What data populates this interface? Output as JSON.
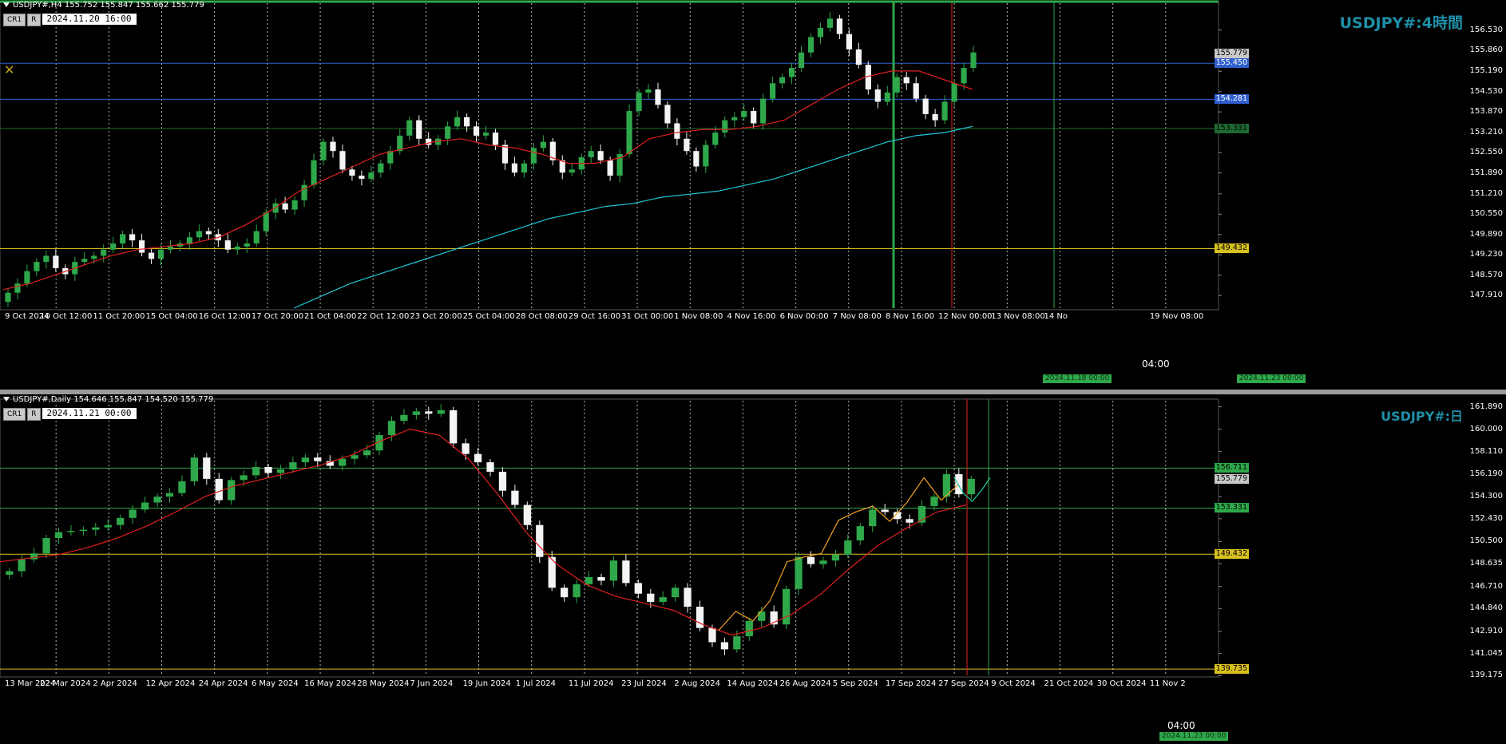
{
  "top": {
    "header": "USDJPY#,H4  155.752 155.847 155.662 155.779",
    "btn1": "CR1",
    "btn2": "R",
    "datetime": "2024.11.20 16:00",
    "title": "USDJPY#:4時間",
    "time_marker": "04:00",
    "x_badge1": "2024.11.18 00:00",
    "x_badge2": "2024.11.23 00:00",
    "chart_data": {
      "type": "candlestick",
      "symbol": "USDJPY#",
      "timeframe": "H4",
      "ylim": [
        147.5,
        157.4
      ],
      "y_ticks": [
        "156.530",
        "155.860",
        "155.190",
        "154.530",
        "153.870",
        "153.210",
        "152.550",
        "151.890",
        "151.210",
        "150.550",
        "149.890",
        "149.230",
        "148.570",
        "147.910"
      ],
      "x_ticks": [
        "9 Oct 2024",
        "10 Oct 12:00",
        "11 Oct 20:00",
        "15 Oct 04:00",
        "16 Oct 12:00",
        "17 Oct 20:00",
        "21 Oct 04:00",
        "22 Oct 12:00",
        "23 Oct 20:00",
        "25 Oct 04:00",
        "28 Oct 08:00",
        "29 Oct 16:00",
        "31 Oct 00:00",
        "1 Nov 08:00",
        "4 Nov 16:00",
        "6 Nov 00:00",
        "7 Nov 08:00",
        "8 Nov 16:00",
        "12 Nov 00:00",
        "13 Nov 08:00",
        "14 No",
        "",
        "19 Nov 08:00"
      ],
      "closes": [
        148.0,
        148.3,
        148.7,
        149.0,
        149.2,
        148.8,
        148.6,
        149.0,
        149.1,
        149.2,
        149.4,
        149.6,
        149.9,
        149.7,
        149.3,
        149.1,
        149.4,
        149.5,
        149.6,
        149.8,
        150.0,
        149.9,
        149.7,
        149.4,
        149.5,
        149.6,
        150.0,
        150.6,
        150.9,
        150.7,
        151.0,
        151.5,
        152.3,
        152.9,
        152.6,
        152.0,
        151.8,
        151.7,
        151.9,
        152.2,
        152.6,
        153.1,
        153.6,
        153.0,
        152.8,
        153.0,
        153.4,
        153.7,
        153.4,
        153.1,
        153.2,
        152.8,
        152.2,
        151.9,
        152.2,
        152.7,
        152.9,
        152.3,
        151.9,
        152.0,
        152.4,
        152.6,
        152.3,
        151.8,
        152.5,
        153.9,
        154.5,
        154.6,
        154.1,
        153.5,
        153.0,
        152.6,
        152.1,
        152.8,
        153.2,
        153.6,
        153.7,
        153.9,
        153.5,
        154.3,
        154.8,
        155.0,
        155.3,
        155.8,
        156.3,
        156.6,
        156.9,
        156.4,
        155.9,
        155.4,
        154.6,
        154.2,
        154.5,
        155.0,
        154.8,
        154.3,
        153.8,
        153.6,
        154.2,
        154.8,
        155.3,
        155.8
      ],
      "moving_averages": [
        {
          "color": "#e02020",
          "values": [
            148.1,
            148.3,
            148.6,
            148.9,
            149.2,
            149.4,
            149.5,
            149.6,
            149.8,
            150.2,
            150.7,
            151.3,
            151.7,
            152.1,
            152.5,
            152.7,
            152.9,
            153.0,
            152.8,
            152.7,
            152.5,
            152.2,
            152.2,
            152.4,
            153.0,
            153.2,
            153.3,
            153.3,
            153.4,
            153.6,
            154.1,
            154.6,
            155.0,
            155.2,
            155.2,
            154.9,
            154.6
          ]
        },
        {
          "color": "#20c8d8",
          "values": [
            147.5,
            147.9,
            148.3,
            148.6,
            148.9,
            149.2,
            149.5,
            149.8,
            150.1,
            150.4,
            150.6,
            150.8,
            150.9,
            151.1,
            151.2,
            151.3,
            151.5,
            151.7,
            152.0,
            152.3,
            152.6,
            152.9,
            153.1,
            153.2,
            153.4
          ]
        }
      ],
      "horizontal_levels": [
        {
          "label": "155.779",
          "value": 155.779,
          "color": "#c8c8c8"
        },
        {
          "label": "155.450",
          "value": 155.45,
          "color": "#3060d0"
        },
        {
          "label": "154.281",
          "value": 154.281,
          "color": "#3060d0"
        },
        {
          "label": "153.331",
          "value": 153.331,
          "color": "#1e6b30"
        },
        {
          "label": "149.432",
          "value": 149.432,
          "color": "#d8c020"
        }
      ]
    }
  },
  "bottom": {
    "header": "USDJPY#,Daily  154.646 155.847 154.520 155.779",
    "btn1": "CR1",
    "btn2": "R",
    "datetime": "2024.11.21 00:00",
    "title": "USDJPY#:日",
    "time_marker": "04:00",
    "x_badge1": "2024.11.23 00:00",
    "chart_data": {
      "type": "candlestick",
      "symbol": "USDJPY#",
      "timeframe": "Daily",
      "ylim": [
        139.2,
        162.4
      ],
      "y_ticks": [
        "161.890",
        "160.000",
        "158.110",
        "156.190",
        "154.300",
        "152.430",
        "150.500",
        "148.635",
        "146.710",
        "144.840",
        "142.910",
        "141.045",
        "139.175"
      ],
      "x_ticks": [
        "13 Mar 2024",
        "22 Mar 2024",
        "2 Apr 2024",
        "12 Apr 2024",
        "24 Apr 2024",
        "6 May 2024",
        "16 May 2024",
        "28 May 2024",
        "7 Jun 2024",
        "19 Jun 2024",
        "1 Jul 2024",
        "11 Jul 2024",
        "23 Jul 2024",
        "2 Aug 2024",
        "14 Aug 2024",
        "26 Aug 2024",
        "5 Sep 2024",
        "17 Sep 2024",
        "27 Sep 2024",
        "9 Oct 2024",
        "21 Oct 2024",
        "30 Oct 2024",
        "11 Nov 2"
      ],
      "closes": [
        148.0,
        149.0,
        149.5,
        150.8,
        151.3,
        151.4,
        151.5,
        151.7,
        151.9,
        152.5,
        153.2,
        153.8,
        154.3,
        154.6,
        155.6,
        157.6,
        155.8,
        154.0,
        155.7,
        156.1,
        156.8,
        156.3,
        156.6,
        157.2,
        157.6,
        157.3,
        156.9,
        157.5,
        157.8,
        158.2,
        159.5,
        160.7,
        161.2,
        161.5,
        161.3,
        161.6,
        158.8,
        157.9,
        157.2,
        156.4,
        154.8,
        153.6,
        151.9,
        149.2,
        146.6,
        145.8,
        146.9,
        147.5,
        147.2,
        148.9,
        147.0,
        146.1,
        145.4,
        145.8,
        146.6,
        145.0,
        143.2,
        142.0,
        141.4,
        142.5,
        143.8,
        144.6,
        143.5,
        146.5,
        149.2,
        148.6,
        148.9,
        149.4,
        150.6,
        151.8,
        153.2,
        153.0,
        152.4,
        152.1,
        153.5,
        154.3,
        156.2,
        154.5,
        155.8
      ],
      "moving_averages": [
        {
          "color": "#e02020",
          "values": [
            148.8,
            149.1,
            149.4,
            150.0,
            150.8,
            151.8,
            153.0,
            154.3,
            155.2,
            155.8,
            156.4,
            157.0,
            157.8,
            159.0,
            160.0,
            159.5,
            157.5,
            154.5,
            151.2,
            148.6,
            146.9,
            145.9,
            145.3,
            144.7,
            143.5,
            142.6,
            143.2,
            144.3,
            146.0,
            148.2,
            150.2,
            151.7,
            153.0,
            153.6
          ]
        },
        {
          "color": "#f0a020",
          "values": [
            143.0,
            144.6,
            143.8,
            145.5,
            148.8,
            149.2,
            149.5,
            152.3,
            153.0,
            153.5,
            152.2,
            153.8,
            155.9,
            154.0,
            155.3
          ]
        },
        {
          "color": "#20c8a0",
          "values": [
            155.9,
            154.6,
            153.9,
            154.8,
            155.9
          ]
        }
      ],
      "horizontal_levels": [
        {
          "label": "156.711",
          "value": 156.711,
          "color": "#2ea84a"
        },
        {
          "label": "155.779",
          "value": 155.779,
          "color": "#c8c8c8"
        },
        {
          "label": "153.331",
          "value": 153.331,
          "color": "#2ea84a"
        },
        {
          "label": "149.432",
          "value": 149.432,
          "color": "#d8c020"
        },
        {
          "label": "139.735",
          "value": 139.735,
          "color": "#d8c020"
        }
      ]
    }
  }
}
